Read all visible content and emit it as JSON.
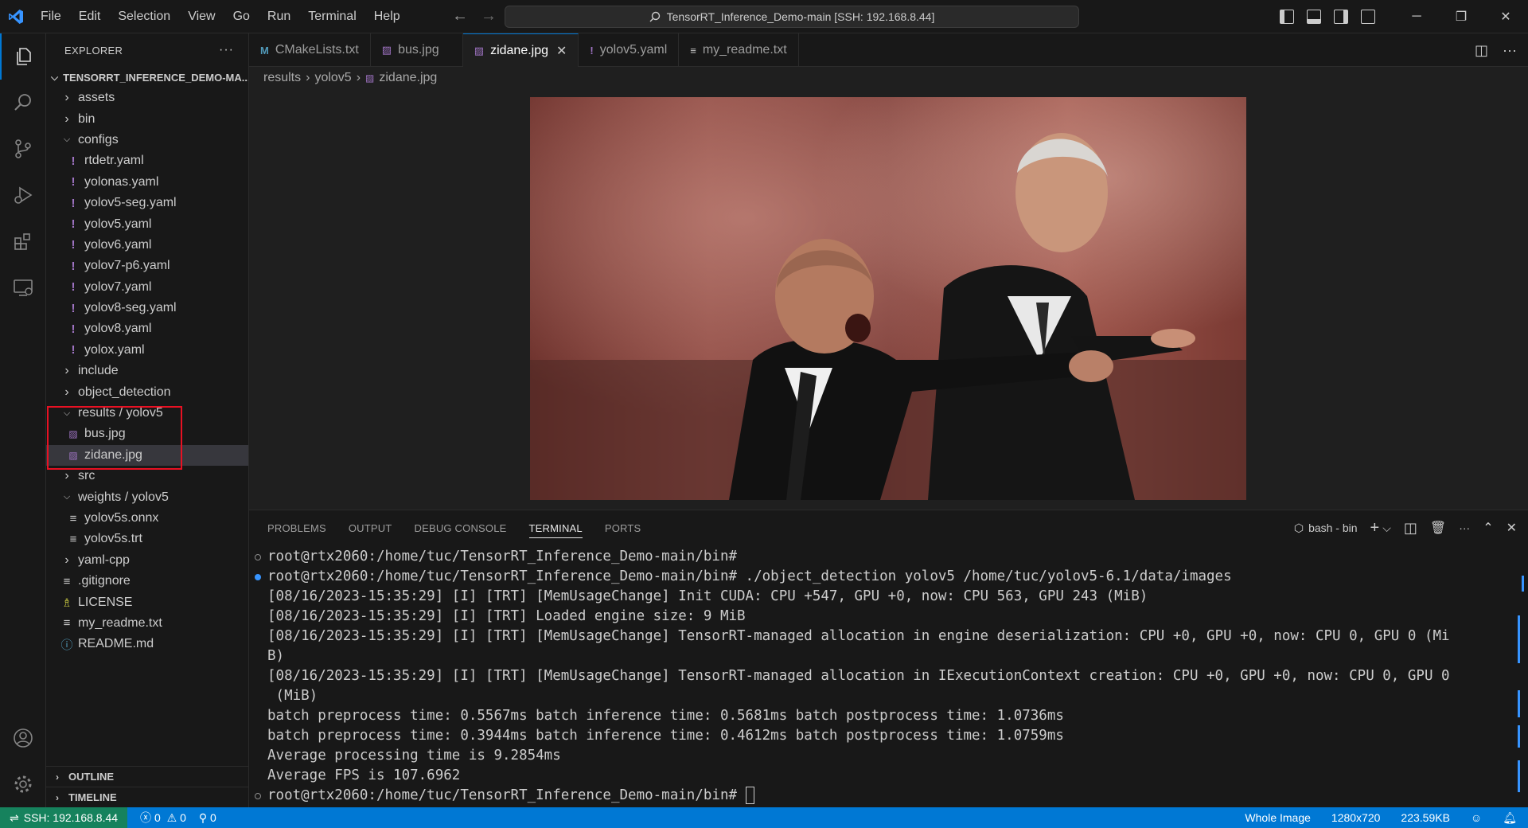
{
  "titlebar": {
    "menu": [
      "File",
      "Edit",
      "Selection",
      "View",
      "Go",
      "Run",
      "Terminal",
      "Help"
    ],
    "command_center": "TensorRT_Inference_Demo-main [SSH: 192.168.8.44]",
    "window_controls": [
      "minimize",
      "restore",
      "close"
    ]
  },
  "explorer": {
    "header": "EXPLORER",
    "more": "···",
    "root": "TENSORRT_INFERENCE_DEMO-MA...",
    "items": [
      {
        "label": "assets",
        "type": "folder",
        "expanded": false,
        "depth": 1
      },
      {
        "label": "bin",
        "type": "folder",
        "expanded": false,
        "depth": 1
      },
      {
        "label": "configs",
        "type": "folder",
        "expanded": true,
        "depth": 1
      },
      {
        "label": "rtdetr.yaml",
        "type": "yaml",
        "depth": 2
      },
      {
        "label": "yolonas.yaml",
        "type": "yaml",
        "depth": 2
      },
      {
        "label": "yolov5-seg.yaml",
        "type": "yaml",
        "depth": 2
      },
      {
        "label": "yolov5.yaml",
        "type": "yaml",
        "depth": 2
      },
      {
        "label": "yolov6.yaml",
        "type": "yaml",
        "depth": 2
      },
      {
        "label": "yolov7-p6.yaml",
        "type": "yaml",
        "depth": 2
      },
      {
        "label": "yolov7.yaml",
        "type": "yaml",
        "depth": 2
      },
      {
        "label": "yolov8-seg.yaml",
        "type": "yaml",
        "depth": 2
      },
      {
        "label": "yolov8.yaml",
        "type": "yaml",
        "depth": 2
      },
      {
        "label": "yolox.yaml",
        "type": "yaml",
        "depth": 2
      },
      {
        "label": "include",
        "type": "folder",
        "expanded": false,
        "depth": 1
      },
      {
        "label": "object_detection",
        "type": "folder",
        "expanded": false,
        "depth": 1
      },
      {
        "label": "results / yolov5",
        "type": "folder",
        "expanded": true,
        "depth": 1
      },
      {
        "label": "bus.jpg",
        "type": "img",
        "depth": 2
      },
      {
        "label": "zidane.jpg",
        "type": "img",
        "depth": 2,
        "selected": true
      },
      {
        "label": "src",
        "type": "folder",
        "expanded": false,
        "depth": 1
      },
      {
        "label": "weights / yolov5",
        "type": "folder",
        "expanded": true,
        "depth": 1
      },
      {
        "label": "yolov5s.onnx",
        "type": "txt",
        "depth": 2
      },
      {
        "label": "yolov5s.trt",
        "type": "txt",
        "depth": 2
      },
      {
        "label": "yaml-cpp",
        "type": "folder",
        "expanded": false,
        "depth": 1
      },
      {
        "label": ".gitignore",
        "type": "txt",
        "depth": 1
      },
      {
        "label": "LICENSE",
        "type": "lic",
        "depth": 1
      },
      {
        "label": "my_readme.txt",
        "type": "txt",
        "depth": 1
      },
      {
        "label": "README.md",
        "type": "info",
        "depth": 1
      }
    ],
    "outline": "OUTLINE",
    "timeline": "TIMELINE"
  },
  "tabs": [
    {
      "label": "CMakeLists.txt",
      "icon": "M",
      "icon_color": "#519aba",
      "active": false
    },
    {
      "label": "bus.jpg",
      "icon": "▨",
      "icon_color": "#a074c4",
      "active": false
    },
    {
      "label": "zidane.jpg",
      "icon": "▨",
      "icon_color": "#a074c4",
      "active": true
    },
    {
      "label": "yolov5.yaml",
      "icon": "!",
      "icon_color": "#a074c4",
      "active": false
    },
    {
      "label": "my_readme.txt",
      "icon": "≡",
      "icon_color": "#cccccc",
      "active": false
    }
  ],
  "breadcrumb": {
    "part1": "results",
    "part2": "yolov5",
    "part3": "zidane.jpg"
  },
  "panel": {
    "tabs": [
      "PROBLEMS",
      "OUTPUT",
      "DEBUG CONSOLE",
      "TERMINAL",
      "PORTS"
    ],
    "active_tab": "TERMINAL",
    "terminal_name": "bash - bin",
    "lines": [
      {
        "text": "root@rtx2060:/home/tuc/TensorRT_Inference_Demo-main/bin#",
        "marker": "hollow"
      },
      {
        "text": "root@rtx2060:/home/tuc/TensorRT_Inference_Demo-main/bin# ./object_detection yolov5 /home/tuc/yolov5-6.1/data/images",
        "marker": "blue"
      },
      {
        "text": "[08/16/2023-15:35:29] [I] [TRT] [MemUsageChange] Init CUDA: CPU +547, GPU +0, now: CPU 563, GPU 243 (MiB)",
        "marker": ""
      },
      {
        "text": "[08/16/2023-15:35:29] [I] [TRT] Loaded engine size: 9 MiB",
        "marker": ""
      },
      {
        "text": "[08/16/2023-15:35:29] [I] [TRT] [MemUsageChange] TensorRT-managed allocation in engine deserialization: CPU +0, GPU +0, now: CPU 0, GPU 0 (Mi",
        "marker": ""
      },
      {
        "text": "B)",
        "marker": ""
      },
      {
        "text": "[08/16/2023-15:35:29] [I] [TRT] [MemUsageChange] TensorRT-managed allocation in IExecutionContext creation: CPU +0, GPU +0, now: CPU 0, GPU 0",
        "marker": ""
      },
      {
        "text": " (MiB)",
        "marker": ""
      },
      {
        "text": "batch preprocess time: 0.5567ms batch inference time: 0.5681ms batch postprocess time: 1.0736ms",
        "marker": ""
      },
      {
        "text": "batch preprocess time: 0.3944ms batch inference time: 0.4612ms batch postprocess time: 1.0759ms",
        "marker": ""
      },
      {
        "text": "Average processing time is 9.2854ms",
        "marker": ""
      },
      {
        "text": "Average FPS is 107.6962",
        "marker": ""
      },
      {
        "text": "root@rtx2060:/home/tuc/TensorRT_Inference_Demo-main/bin# ",
        "marker": "hollow",
        "cursor": true
      }
    ]
  },
  "statusbar": {
    "remote": "SSH: 192.168.8.44",
    "errors": "0",
    "warnings": "0",
    "ports": "0",
    "image_mode": "Whole Image",
    "dimensions": "1280x720",
    "size": "223.59KB"
  },
  "colors": {
    "accent": "#0078d4",
    "remote": "#16825d",
    "highlight_box": "#e81123"
  }
}
